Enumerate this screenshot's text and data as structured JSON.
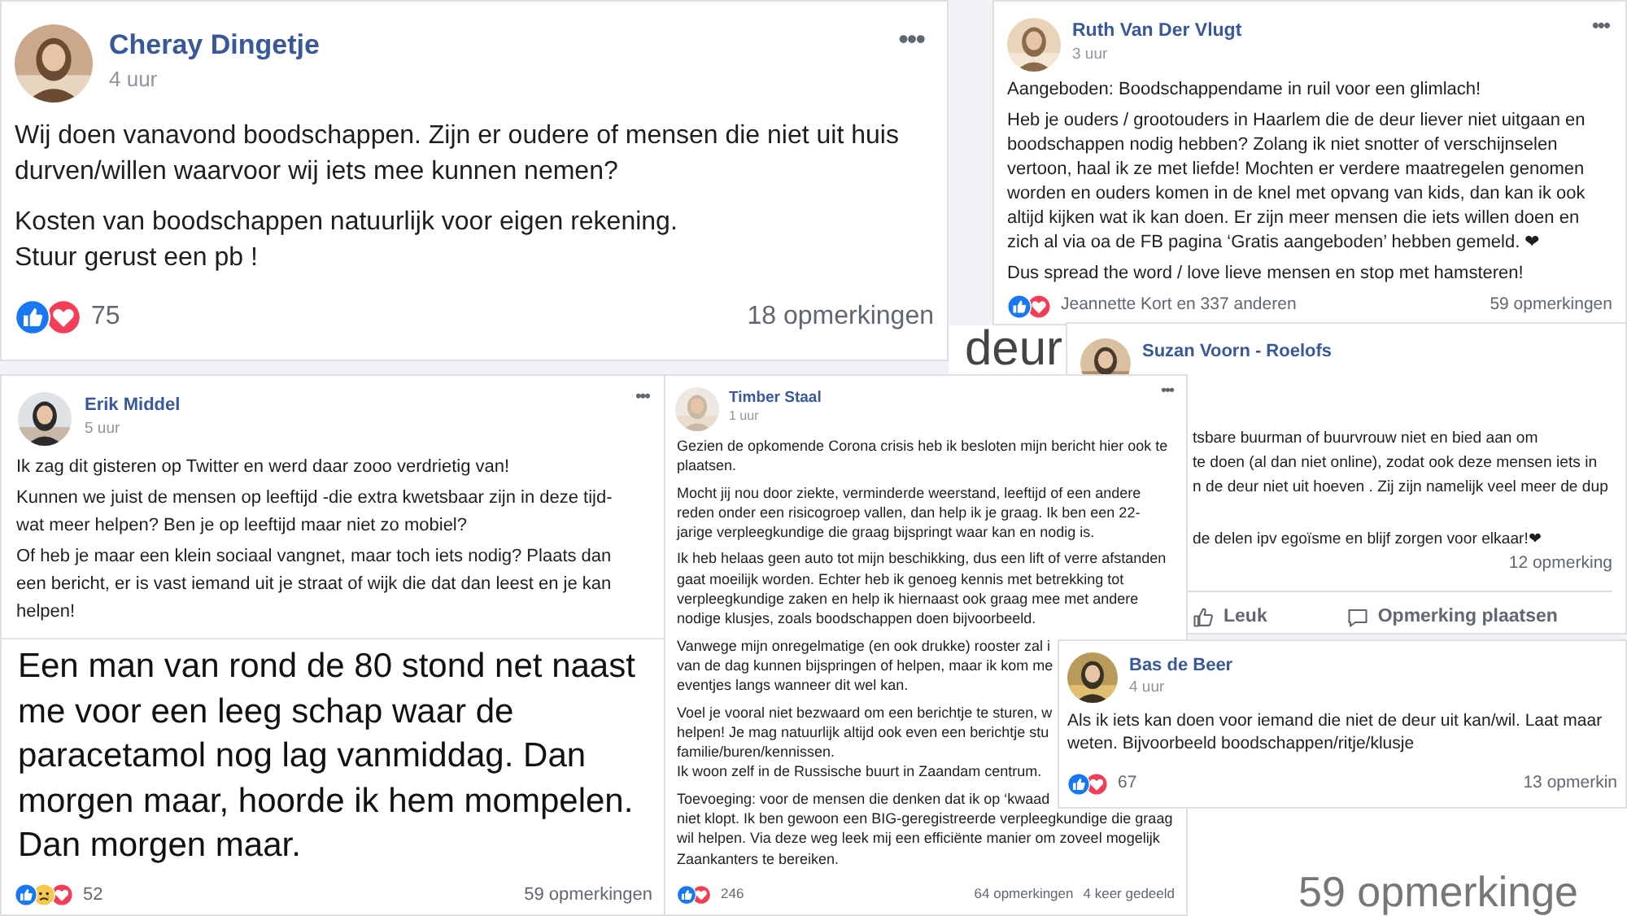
{
  "posts": [
    {
      "author": "Cheray Dingetje",
      "time": "4 uur",
      "menu": "•••",
      "paragraphs": [
        [
          "Wij doen vanavond boodschappen. Zijn er oudere of mensen die niet uit huis",
          "durven/willen waarvoor wij iets mee kunnen nemen?"
        ],
        [
          "Kosten van boodschappen natuurlijk voor eigen rekening.",
          "Stuur gerust een pb !"
        ]
      ],
      "reactions": [
        {
          "kind": "like"
        },
        {
          "kind": "love"
        }
      ],
      "reaction_text": "75",
      "comments": "18 opmerkingen"
    },
    {
      "author": "Ruth Van Der Vlugt",
      "time": "3 uur",
      "menu": "•••",
      "paragraphs": [
        [
          "Aangeboden: Boodschappendame in ruil voor een glimlach!"
        ],
        [
          "Heb je ouders / grootouders in Haarlem die de deur liever niet uitgaan en",
          "boodschappen nodig hebben? Zolang ik niet snotter of verschijnselen",
          "vertoon, haal ik ze met liefde! Mochten er verdere maatregelen genomen",
          "worden en ouders komen in de knel met opvang van kids, dan kan ik ook",
          "altijd kijken wat ik kan doen. Er zijn meer mensen die iets willen doen en",
          "zich al via oa de FB pagina ‘Gratis aangeboden’ hebben gemeld. ❤"
        ],
        [
          "Dus spread the word / love lieve mensen en stop met hamsteren!"
        ]
      ],
      "reactions": [
        {
          "kind": "like"
        },
        {
          "kind": "love"
        }
      ],
      "reaction_text": "Jeannette Kort en 337 anderen",
      "comments": "59 opmerkingen"
    },
    {
      "author": "Suzan Voorn - Roelofs",
      "paragraphs": [
        [
          "tsbare buurman of buurvrouw niet en bied aan om",
          "te doen (al dan niet online), zodat ook deze mensen iets in",
          "n de deur niet uit hoeven . Zij zijn namelijk veel meer de dup"
        ],
        [
          "de delen ipv egoïsme en blijf zorgen voor elkaar!❤"
        ]
      ],
      "comments": "12 opmerking",
      "actions": [
        {
          "kind": "like",
          "label": "Leuk"
        },
        {
          "kind": "comment",
          "label": "Opmerking plaatsen"
        }
      ]
    },
    {
      "author": "Erik Middel",
      "time": "5 uur",
      "menu": "•••",
      "paragraphs": [
        [
          "Ik zag dit gisteren op Twitter en werd daar zooo verdrietig van!"
        ],
        [
          "Kunnen we juist de mensen op leeftijd -die extra kwetsbaar zijn in deze tijd-",
          "wat meer helpen? Ben je op leeftijd maar niet zo mobiel?"
        ],
        [
          "Of heb je maar een klein sociaal vangnet, maar toch iets nodig? Plaats dan",
          "een bericht, er is vast iemand uit je straat of wijk die dat dan leest en je kan",
          "helpen!"
        ]
      ],
      "attachment": [
        "Een man van rond de 80 stond net naast",
        "me voor een leeg schap waar de",
        "paracetamol nog lag vanmiddag. Dan",
        "morgen maar, hoorde ik hem mompelen.",
        "Dan morgen maar."
      ],
      "reactions": [
        {
          "kind": "like"
        },
        {
          "kind": "sad"
        },
        {
          "kind": "love"
        }
      ],
      "reaction_text": "52",
      "comments": "59 opmerkingen"
    },
    {
      "author": "Timber Staal",
      "time": "1 uur",
      "menu": "•••",
      "paragraphs": [
        [
          "Gezien de opkomende Corona crisis heb ik besloten mijn bericht hier ook te",
          "plaatsen."
        ],
        [
          "Mocht jij nou door ziekte, verminderde weerstand, leeftijd of een andere",
          "reden onder een risicogroep vallen, dan help ik je graag. Ik ben een 22-",
          "jarige verpleegkundige die graag bijspringt waar kan en nodig is."
        ],
        [
          "Ik heb helaas geen auto tot mijn beschikking, dus een lift of verre afstanden",
          "gaat moeilijk worden. Echter heb ik genoeg kennis met betrekking tot",
          "verpleegkundige zaken en help ik hiernaast ook graag mee met andere",
          "nodige klusjes, zoals boodschappen doen bijvoorbeeld."
        ],
        [
          "Vanwege mijn onregelmatige (en ook drukke) rooster zal i",
          "van de dag kunnen bijspringen of helpen, maar ik kom me",
          "eventjes langs wanneer dit wel kan."
        ],
        [
          "Voel je vooral niet bezwaard om een berichtje te sturen, w",
          "helpen! Je mag natuurlijk altijd ook even een berichtje stu",
          "familie/buren/kennissen.",
          "Ik woon zelf in de Russische buurt in Zaandam centrum."
        ],
        [
          "Toevoeging: voor de mensen die denken dat ik op ‘kwaad",
          "niet klopt. Ik ben gewoon een BIG-geregistreerde verpleegkundige die graag",
          "wil helpen. Via deze weg leek mij een efficiënte manier om zoveel mogelijk",
          "Zaankanters te bereiken."
        ]
      ],
      "reactions": [
        {
          "kind": "like"
        },
        {
          "kind": "love"
        }
      ],
      "reaction_text": "246",
      "comments": "64 opmerkingen",
      "shares": "4 keer gedeeld"
    },
    {
      "author": "Bas de Beer",
      "time": "4 uur",
      "paragraphs": [
        [
          "Als ik iets kan doen voor iemand die niet de deur uit kan/wil. Laat maar",
          "weten. Bijvoorbeeld boodschappen/ritje/klusje"
        ]
      ],
      "reactions": [
        {
          "kind": "like"
        },
        {
          "kind": "love"
        }
      ],
      "reaction_text": "67",
      "comments": "13 opmerkin"
    }
  ],
  "fragments": [
    {
      "text": "deur"
    },
    {
      "text": "59 opmerkinge"
    }
  ]
}
